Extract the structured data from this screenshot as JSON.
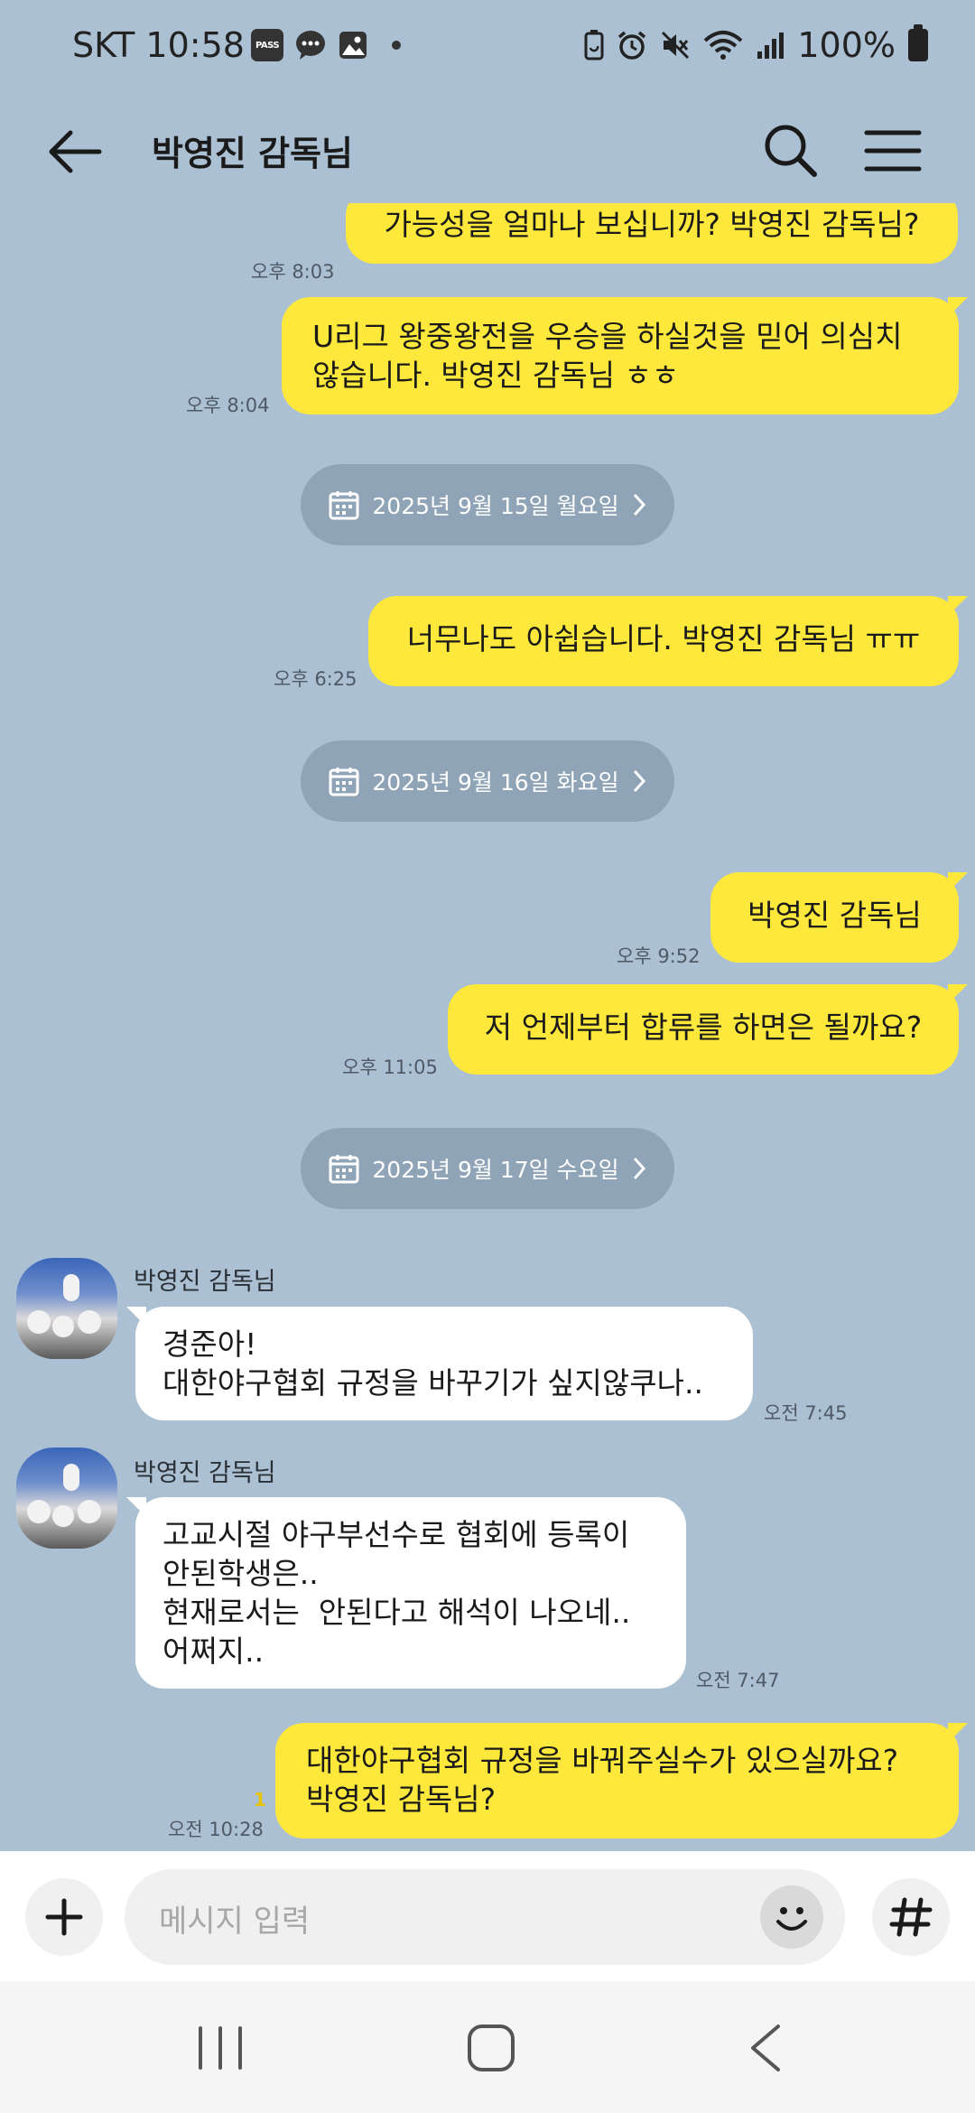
{
  "status_bar": {
    "carrier": "SKT",
    "time": "10:58",
    "pass_badge": "PASS",
    "battery": "100%",
    "icons": [
      "pass-icon",
      "message-icon",
      "gallery-icon",
      "dot-icon",
      "battery-saver-icon",
      "alarm-icon",
      "mute-icon",
      "wifi-icon",
      "signal-icon",
      "battery-icon"
    ]
  },
  "header": {
    "title": "박영진 감독님",
    "icons": [
      "back-arrow-icon",
      "search-icon",
      "menu-icon"
    ]
  },
  "messages": [
    {
      "type": "me",
      "text": "가능성을 얼마나 보십니까? 박영진 감독님?",
      "time": "오후 8:03"
    },
    {
      "type": "me",
      "lines": [
        "U리그 왕중왕전을 우승을 하실것을 믿어 의심치",
        "않습니다. 박영진 감독님 ㅎㅎ"
      ],
      "time": "오후 8:04"
    },
    {
      "type": "date",
      "text": "2025년 9월 15일 월요일"
    },
    {
      "type": "me",
      "text": "너무나도 아쉽습니다. 박영진 감독님 ㅠㅠ",
      "time": "오후 6:25"
    },
    {
      "type": "date",
      "text": "2025년 9월 16일 화요일"
    },
    {
      "type": "me",
      "text": "박영진 감독님",
      "time": "오후 9:52"
    },
    {
      "type": "me",
      "text": "저 언제부터 합류를 하면은 될까요?",
      "time": "오후 11:05"
    },
    {
      "type": "date",
      "text": "2025년 9월 17일 수요일"
    },
    {
      "type": "them",
      "sender": "박영진 감독님",
      "lines": [
        "경준아!",
        "대한야구협회 규정을 바꾸기가 싶지않쿠나.."
      ],
      "time": "오전 7:45"
    },
    {
      "type": "them",
      "sender": "박영진 감독님",
      "lines": [
        "고교시절 야구부선수로 협회에 등록이",
        "안된학생은..",
        "현재로서는  안된다고 해석이 나오네..",
        "어쩌지.."
      ],
      "time": "오전 7:47"
    },
    {
      "type": "me",
      "lines": [
        "대한야구협회 규정을 바꿔주실수가 있으실까요?",
        "박영진 감독님?"
      ],
      "time": "오전 10:28",
      "unread": "1"
    }
  ],
  "input_bar": {
    "placeholder": "메시지 입력",
    "icons": [
      "plus-icon",
      "emoji-icon",
      "hash-icon"
    ]
  },
  "nav_bar": {
    "icons": [
      "recents-icon",
      "home-icon",
      "nav-back-icon"
    ]
  },
  "colors": {
    "background": "#abc0d3",
    "my_bubble": "#fde83b",
    "their_bubble": "#ffffff",
    "date_pill": "#8fa4b6",
    "unread": "#e8c400"
  }
}
